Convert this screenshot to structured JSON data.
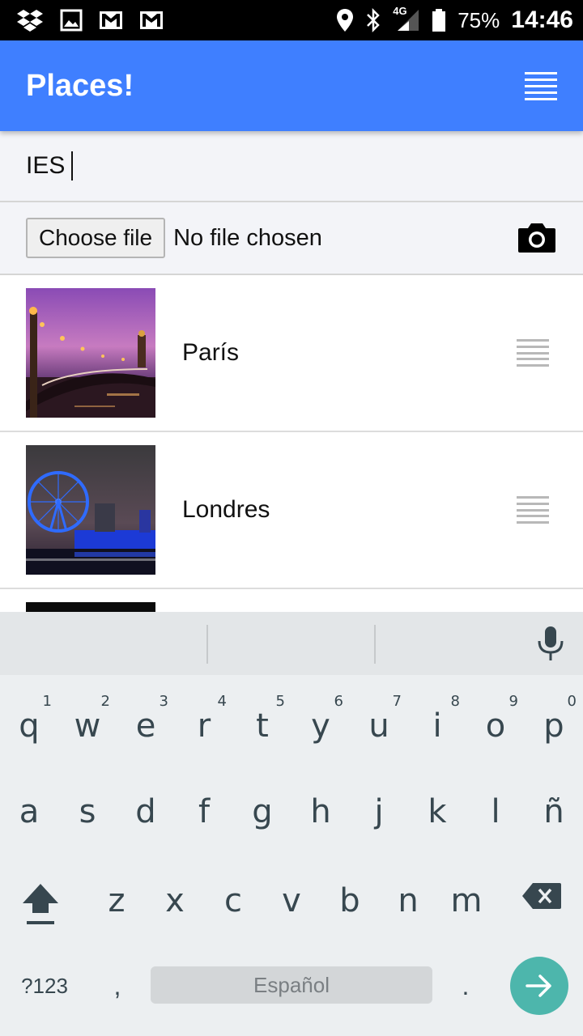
{
  "status_bar": {
    "battery": "75%",
    "time": "14:46",
    "network": "4G",
    "icons_left": [
      "dropbox-icon",
      "image-icon",
      "gmail-icon",
      "gmail-icon"
    ],
    "icons_right": [
      "location-icon",
      "bluetooth-icon",
      "signal-icon",
      "battery-icon"
    ]
  },
  "app_bar": {
    "title": "Places!",
    "menu_icon": "menu-icon",
    "color": "#3f7fff"
  },
  "place_input": {
    "value": "IES"
  },
  "file_picker": {
    "button_label": "Choose file",
    "status": "No file chosen",
    "camera_icon": "camera-icon"
  },
  "places": [
    {
      "label": "París",
      "image": "paris-thumbnail"
    },
    {
      "label": "Londres",
      "image": "london-thumbnail"
    }
  ],
  "keyboard": {
    "row1": [
      {
        "key": "q",
        "hint": "1"
      },
      {
        "key": "w",
        "hint": "2"
      },
      {
        "key": "e",
        "hint": "3"
      },
      {
        "key": "r",
        "hint": "4"
      },
      {
        "key": "t",
        "hint": "5"
      },
      {
        "key": "y",
        "hint": "6"
      },
      {
        "key": "u",
        "hint": "7"
      },
      {
        "key": "i",
        "hint": "8"
      },
      {
        "key": "o",
        "hint": "9"
      },
      {
        "key": "p",
        "hint": "0"
      }
    ],
    "row2": [
      "a",
      "s",
      "d",
      "f",
      "g",
      "h",
      "j",
      "k",
      "l",
      "ñ"
    ],
    "row3": [
      "z",
      "x",
      "c",
      "v",
      "b",
      "n",
      "m"
    ],
    "symbols_label": "?123",
    "comma": ",",
    "period": ".",
    "space_label": "Español",
    "accent_color": "#4db6ac"
  }
}
